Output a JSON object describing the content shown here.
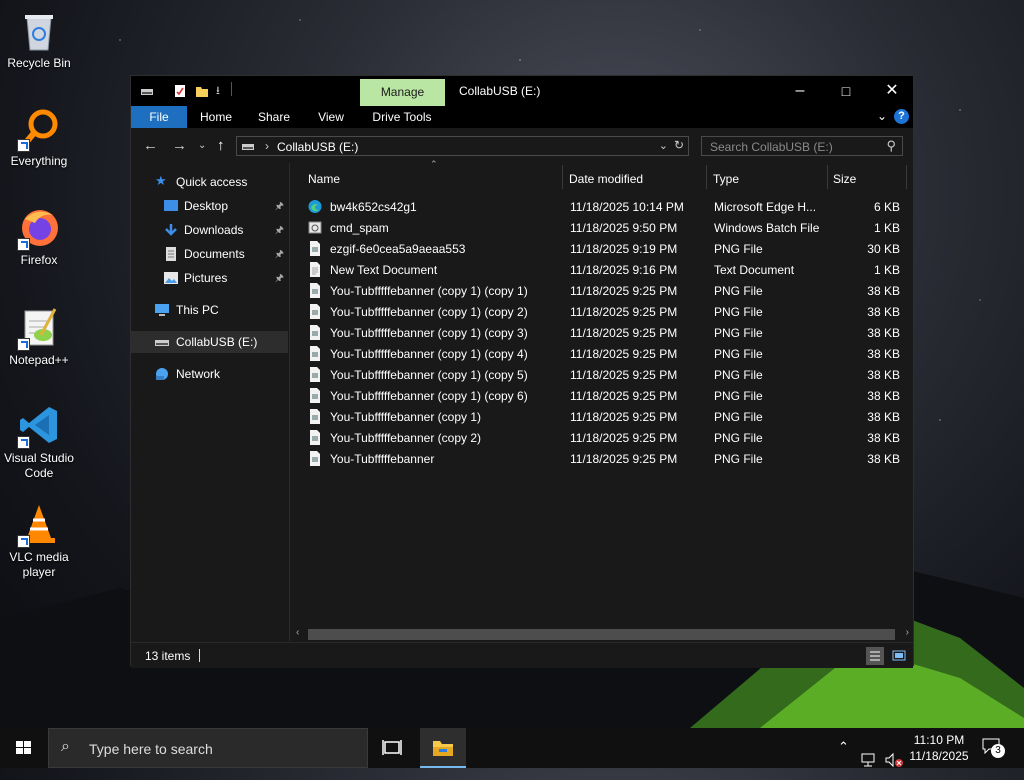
{
  "desktop": {
    "icons": [
      {
        "label": "Recycle Bin",
        "icon": "recycle-bin-icon"
      },
      {
        "label": "Everything",
        "icon": "everything-search-icon"
      },
      {
        "label": "Firefox",
        "icon": "firefox-icon"
      },
      {
        "label": "Notepad++",
        "icon": "notepad-plus-plus-icon"
      },
      {
        "label": "Visual Studio Code",
        "icon": "vscode-icon"
      },
      {
        "label": "VLC media player",
        "icon": "vlc-icon"
      }
    ]
  },
  "window": {
    "title": "CollabUSB (E:)",
    "contextual_tab": "Manage",
    "ribbon_tabs": [
      "File",
      "Home",
      "Share",
      "View",
      "Drive Tools"
    ],
    "address": {
      "crumb": "CollabUSB (E:)"
    },
    "search_placeholder": "Search CollabUSB (E:)",
    "nav": {
      "quick_access": "Quick access",
      "items": [
        {
          "label": "Desktop",
          "pinned": true
        },
        {
          "label": "Downloads",
          "pinned": true
        },
        {
          "label": "Documents",
          "pinned": true
        },
        {
          "label": "Pictures",
          "pinned": true
        }
      ],
      "this_pc": "This PC",
      "drive": "CollabUSB (E:)",
      "network": "Network"
    },
    "columns": [
      "Name",
      "Date modified",
      "Type",
      "Size"
    ],
    "files": [
      {
        "name": "bw4k652cs42g1",
        "date": "11/18/2025 10:14 PM",
        "type": "Microsoft Edge H...",
        "size": "6 KB",
        "icon": "edge-icon"
      },
      {
        "name": "cmd_spam",
        "date": "11/18/2025 9:50 PM",
        "type": "Windows Batch File",
        "size": "1 KB",
        "icon": "batch-file-icon"
      },
      {
        "name": "ezgif-6e0cea5a9aeaa553",
        "date": "11/18/2025 9:19 PM",
        "type": "PNG File",
        "size": "30 KB",
        "icon": "png-file-icon"
      },
      {
        "name": "New Text Document",
        "date": "11/18/2025 9:16 PM",
        "type": "Text Document",
        "size": "1 KB",
        "icon": "text-file-icon"
      },
      {
        "name": "You-Tubfffffebanner (copy 1) (copy 1)",
        "date": "11/18/2025 9:25 PM",
        "type": "PNG File",
        "size": "38 KB",
        "icon": "png-file-icon"
      },
      {
        "name": "You-Tubfffffebanner (copy 1) (copy 2)",
        "date": "11/18/2025 9:25 PM",
        "type": "PNG File",
        "size": "38 KB",
        "icon": "png-file-icon"
      },
      {
        "name": "You-Tubfffffebanner (copy 1) (copy 3)",
        "date": "11/18/2025 9:25 PM",
        "type": "PNG File",
        "size": "38 KB",
        "icon": "png-file-icon"
      },
      {
        "name": "You-Tubfffffebanner (copy 1) (copy 4)",
        "date": "11/18/2025 9:25 PM",
        "type": "PNG File",
        "size": "38 KB",
        "icon": "png-file-icon"
      },
      {
        "name": "You-Tubfffffebanner (copy 1) (copy 5)",
        "date": "11/18/2025 9:25 PM",
        "type": "PNG File",
        "size": "38 KB",
        "icon": "png-file-icon"
      },
      {
        "name": "You-Tubfffffebanner (copy 1) (copy 6)",
        "date": "11/18/2025 9:25 PM",
        "type": "PNG File",
        "size": "38 KB",
        "icon": "png-file-icon"
      },
      {
        "name": "You-Tubfffffebanner (copy 1)",
        "date": "11/18/2025 9:25 PM",
        "type": "PNG File",
        "size": "38 KB",
        "icon": "png-file-icon"
      },
      {
        "name": "You-Tubfffffebanner (copy 2)",
        "date": "11/18/2025 9:25 PM",
        "type": "PNG File",
        "size": "38 KB",
        "icon": "png-file-icon"
      },
      {
        "name": "You-Tubfffffebanner",
        "date": "11/18/2025 9:25 PM",
        "type": "PNG File",
        "size": "38 KB",
        "icon": "png-file-icon"
      }
    ],
    "status": {
      "item_count": "13 items"
    }
  },
  "taskbar": {
    "search_placeholder": "Type here to search",
    "clock": {
      "time": "11:10 PM",
      "date": "11/18/2025"
    },
    "notifications": "3"
  },
  "colors": {
    "accent": "#1e6fc0",
    "manage_tab": "#b9e7a3",
    "window_bg": "#191919"
  }
}
